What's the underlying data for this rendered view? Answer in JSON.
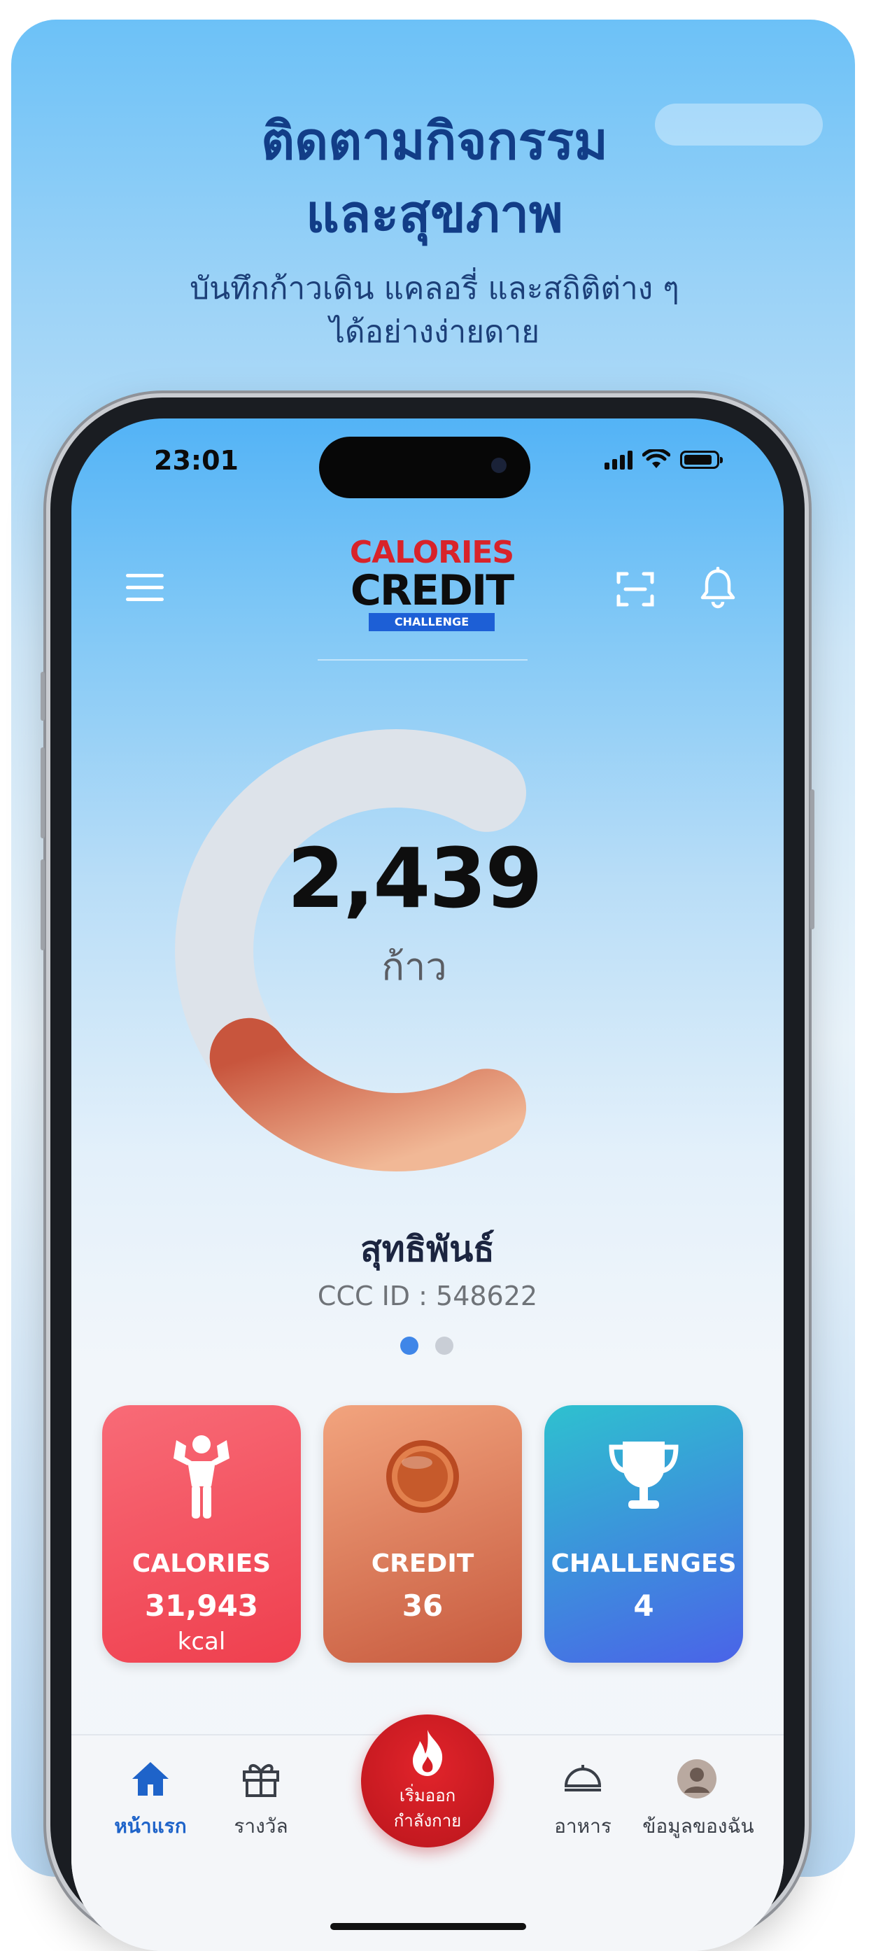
{
  "promo": {
    "title_line1": "ติดตามกิจกรรม",
    "title_line2": "และสุขภาพ",
    "subtitle_line1": "บันทึกก้าวเดิน แคลอรี่ และสถิติต่าง ๆ",
    "subtitle_line2": "ได้อย่างง่ายดาย"
  },
  "status_bar": {
    "time": "23:01"
  },
  "header": {
    "logo_line1": "CALORIES",
    "logo_line2": "CREDIT",
    "logo_line3": "CHALLENGE",
    "icons": [
      "menu-icon",
      "scan-icon",
      "bell-icon"
    ]
  },
  "steps": {
    "value": "2,439",
    "unit": "ก้าว",
    "progress_fraction": 0.35
  },
  "user": {
    "name": "สุทธิพันธ์",
    "id_text": "CCC ID : 548622"
  },
  "pager": {
    "count": 2,
    "active": 1
  },
  "tiles": [
    {
      "label": "CALORIES",
      "value": "31,943",
      "unit": "kcal",
      "icon": "flexing-person-icon",
      "color": "#f2545f"
    },
    {
      "label": "CREDIT",
      "value": "36",
      "unit": "",
      "icon": "coin-icon",
      "color": "#d97654"
    },
    {
      "label": "CHALLENGES",
      "value": "4",
      "unit": "",
      "icon": "trophy-icon",
      "color": "#3b82e6"
    }
  ],
  "nav": {
    "items": [
      {
        "label": "หน้าแรก",
        "icon": "home-icon",
        "active": true
      },
      {
        "label": "รางวัล",
        "icon": "gift-icon",
        "active": false
      },
      {
        "label": "อาหาร",
        "icon": "food-icon",
        "active": false
      },
      {
        "label": "ข้อมูลของฉัน",
        "icon": "avatar-icon",
        "active": false
      }
    ],
    "fab_line1": "เริ่มออก",
    "fab_line2": "กำลังกาย"
  },
  "colors": {
    "accent_blue": "#1e63c9",
    "brand_red": "#d8232a",
    "ring_fill": "#e58a62",
    "ring_track": "#dde3ea"
  }
}
